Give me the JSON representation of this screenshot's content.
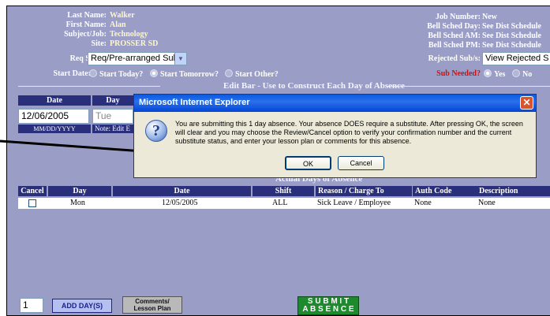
{
  "header": {
    "last_name_label": "Last Name:",
    "last_name": "Walker",
    "first_name_label": "First Name:",
    "first_name": "Alan",
    "subject_label": "Subject/Job:",
    "subject": "Technology",
    "site_label": "Site:",
    "site": "PROSSER SD",
    "req_sub_label": "Req Sub/s:",
    "req_sub_value": "Req/Pre-arranged Sub",
    "start_date_label": "Start Date:",
    "start_today": "Start Today?",
    "start_tomorrow": "Start Tomorrow?",
    "start_other": "Start Other?",
    "job_number_label": "Job Number:",
    "job_number": "New",
    "bell_day_label": "Bell Sched Day:",
    "bell_day": "See Dist Schedule",
    "bell_am_label": "Bell Sched AM:",
    "bell_am": "See Dist Schedule",
    "bell_pm_label": "Bell Sched PM:",
    "bell_pm": "See Dist Schedule",
    "rejected_label": "Rejected Sub/s:",
    "rejected_value": "View Rejected S",
    "sub_needed_label": "Sub Needed?",
    "yes": "Yes",
    "no": "No"
  },
  "edit_bar": {
    "title": "Edit Bar - Use to Construct Each Day of Absence",
    "col_date": "Date",
    "col_day": "Day",
    "date_value": "12/06/2005",
    "day_value": "Tue",
    "date_hint": "MM/DD/YYYY",
    "note": "Note: Edit E"
  },
  "actual_days": {
    "title": "Actual Days of Absence",
    "columns": [
      "Cancel",
      "Day",
      "Date",
      "Shift",
      "Reason / Charge To",
      "Auth Code",
      "Description"
    ],
    "rows": [
      {
        "day": "Mon",
        "date": "12/05/2005",
        "shift": "ALL",
        "reason": "Sick Leave / Employee",
        "auth": "None",
        "description": "None"
      }
    ]
  },
  "footer": {
    "days_count": "1",
    "add_days": "ADD DAY(S)",
    "comments_line1": "Comments/",
    "comments_line2": "Lesson Plan",
    "submit_line1": "S U B M I T",
    "submit_line2": "A B S E N C E"
  },
  "dialog": {
    "title": "Microsoft Internet Explorer",
    "message": "You are submitting this 1 day absence.  Your absence DOES require a substitute.  After pressing OK, the screen will clear and you may choose the Review/Cancel option to verify your confirmation number and the current substitute status, and enter your lesson plan or comments for this absence.",
    "ok": "OK",
    "cancel": "Cancel"
  },
  "colors": {
    "panel": "#9a9ec6",
    "header_bar": "#2a2f7c",
    "title_bar": "#0a5ae0",
    "submit": "#1e8a2e",
    "sub_needed": "#cc1111"
  }
}
